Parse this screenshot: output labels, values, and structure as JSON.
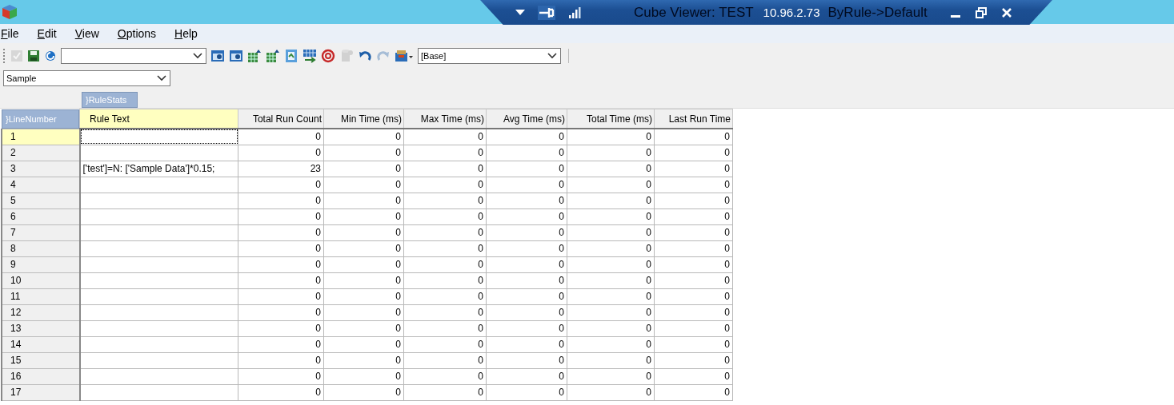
{
  "window": {
    "title_start": "Cube Viewer: TEST",
    "title_end": "ByRule->Default"
  },
  "remote_bar": {
    "host": "10.96.2.73"
  },
  "menu": [
    "File",
    "Edit",
    "View",
    "Options",
    "Help"
  ],
  "toolbar": {
    "buttons": [
      {
        "disabled": true
      },
      {
        "disabled": false
      },
      {
        "disabled": false
      }
    ],
    "tools": [
      {
        "disabled": false
      },
      {
        "disabled": false
      },
      {
        "disabled": false
      },
      {
        "disabled": false
      },
      {
        "disabled": false
      },
      {
        "disabled": false
      },
      {
        "disabled": false
      },
      {
        "disabled": true
      },
      {
        "disabled": false
      },
      {
        "disabled": true
      },
      {
        "disabled": false
      }
    ],
    "subset_combo": {
      "value": "[Base]"
    }
  },
  "title_dim": {
    "value": "Sample"
  },
  "column_dimension": "}RuleStats",
  "row_dimension": "}LineNumber",
  "columns": [
    {
      "label": "Rule Text",
      "selected": true
    },
    {
      "label": "Total Run Count",
      "selected": false
    },
    {
      "label": "Min Time (ms)",
      "selected": false
    },
    {
      "label": "Max Time (ms)",
      "selected": false
    },
    {
      "label": "Avg Time (ms)",
      "selected": false
    },
    {
      "label": "Total Time (ms)",
      "selected": false
    },
    {
      "label": "Last Run Time",
      "selected": false
    }
  ],
  "rows": [
    {
      "line": "1",
      "selected": true,
      "cells": [
        "",
        "0",
        "0",
        "0",
        "0",
        "0",
        "0"
      ]
    },
    {
      "line": "2",
      "selected": false,
      "cells": [
        "",
        "0",
        "0",
        "0",
        "0",
        "0",
        "0"
      ]
    },
    {
      "line": "3",
      "selected": false,
      "cells": [
        "['test']=N: ['Sample Data']*0.15;",
        "23",
        "0",
        "0",
        "0",
        "0",
        "0"
      ]
    },
    {
      "line": "4",
      "selected": false,
      "cells": [
        "",
        "0",
        "0",
        "0",
        "0",
        "0",
        "0"
      ]
    },
    {
      "line": "5",
      "selected": false,
      "cells": [
        "",
        "0",
        "0",
        "0",
        "0",
        "0",
        "0"
      ]
    },
    {
      "line": "6",
      "selected": false,
      "cells": [
        "",
        "0",
        "0",
        "0",
        "0",
        "0",
        "0"
      ]
    },
    {
      "line": "7",
      "selected": false,
      "cells": [
        "",
        "0",
        "0",
        "0",
        "0",
        "0",
        "0"
      ]
    },
    {
      "line": "8",
      "selected": false,
      "cells": [
        "",
        "0",
        "0",
        "0",
        "0",
        "0",
        "0"
      ]
    },
    {
      "line": "9",
      "selected": false,
      "cells": [
        "",
        "0",
        "0",
        "0",
        "0",
        "0",
        "0"
      ]
    },
    {
      "line": "10",
      "selected": false,
      "cells": [
        "",
        "0",
        "0",
        "0",
        "0",
        "0",
        "0"
      ]
    },
    {
      "line": "11",
      "selected": false,
      "cells": [
        "",
        "0",
        "0",
        "0",
        "0",
        "0",
        "0"
      ]
    },
    {
      "line": "12",
      "selected": false,
      "cells": [
        "",
        "0",
        "0",
        "0",
        "0",
        "0",
        "0"
      ]
    },
    {
      "line": "13",
      "selected": false,
      "cells": [
        "",
        "0",
        "0",
        "0",
        "0",
        "0",
        "0"
      ]
    },
    {
      "line": "14",
      "selected": false,
      "cells": [
        "",
        "0",
        "0",
        "0",
        "0",
        "0",
        "0"
      ]
    },
    {
      "line": "15",
      "selected": false,
      "cells": [
        "",
        "0",
        "0",
        "0",
        "0",
        "0",
        "0"
      ]
    },
    {
      "line": "16",
      "selected": false,
      "cells": [
        "",
        "0",
        "0",
        "0",
        "0",
        "0",
        "0"
      ]
    },
    {
      "line": "17",
      "selected": false,
      "cells": [
        "",
        "0",
        "0",
        "0",
        "0",
        "0",
        "0"
      ]
    }
  ]
}
